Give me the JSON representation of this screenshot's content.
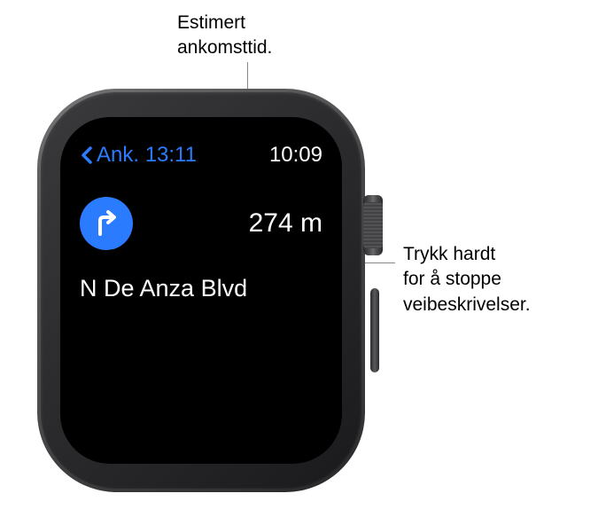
{
  "callouts": {
    "top": "Estimert\nankomsttid.",
    "right": "Trykk hardt\nfor å stoppe\nveibeskrivelser."
  },
  "status_bar": {
    "arrival_label": "Ank. 13:11",
    "current_time": "10:09"
  },
  "navigation": {
    "turn_direction": "right",
    "distance": "274 m",
    "street_name": "N De Anza Blvd"
  },
  "icons": {
    "back": "chevron-left",
    "turn": "turn-right-arrow"
  }
}
